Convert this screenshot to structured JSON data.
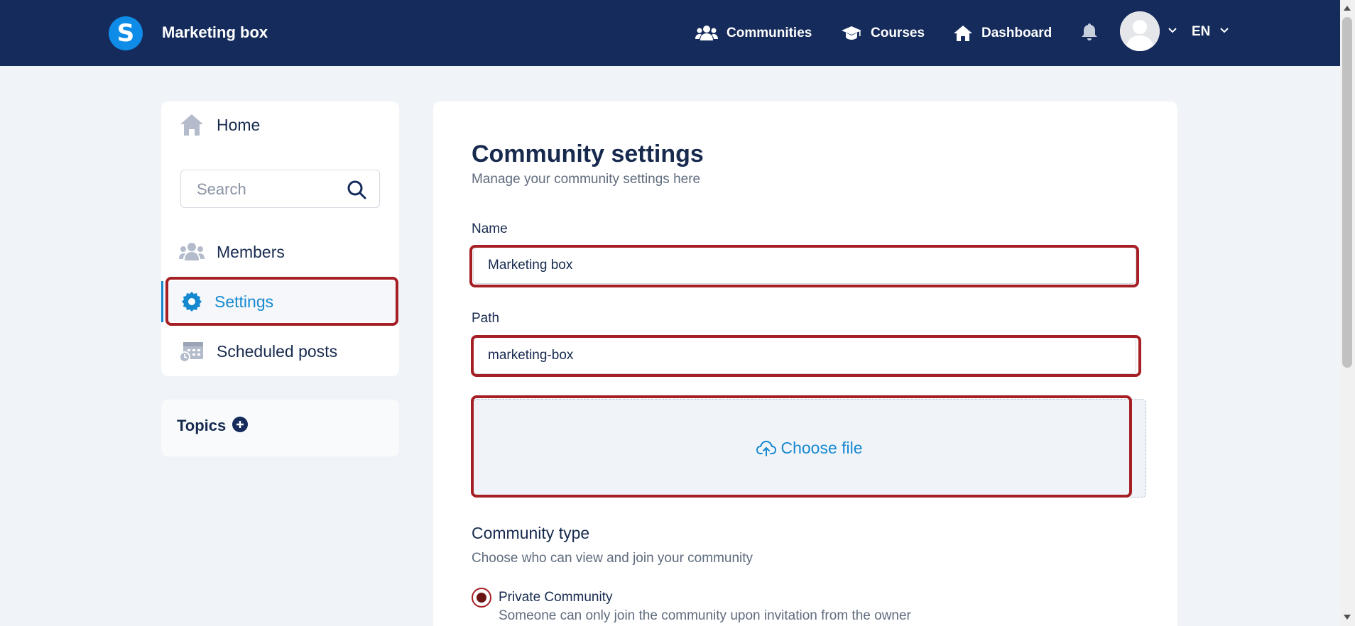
{
  "header": {
    "logo_letter": "S",
    "brand": "Marketing box",
    "nav": [
      {
        "label": "Communities",
        "icon": "users-icon"
      },
      {
        "label": "Courses",
        "icon": "graduation-cap-icon"
      },
      {
        "label": "Dashboard",
        "icon": "home-icon"
      }
    ],
    "language": "EN",
    "bg_color": "#142b5b"
  },
  "sidebar": {
    "home": "Home",
    "search_placeholder": "Search",
    "items": [
      {
        "label": "Members",
        "icon": "members-icon"
      },
      {
        "label": "Settings",
        "icon": "gear-icon"
      },
      {
        "label": "Scheduled posts",
        "icon": "calendar-clock-icon"
      }
    ],
    "topics": "Topics"
  },
  "main": {
    "title": "Community settings",
    "subtitle": "Manage your community settings here",
    "name_label": "Name",
    "name_value": "Marketing box",
    "path_label": "Path",
    "path_value": "marketing-box",
    "choose_file": "Choose file",
    "type_title": "Community type",
    "type_subtitle": "Choose who can view and join your community",
    "private_label": "Private Community",
    "private_desc": "Someone can only join the community upon invitation from the owner"
  },
  "colors": {
    "accent": "#1688d0",
    "highlight": "#a51f24",
    "text": "#172a4e"
  }
}
